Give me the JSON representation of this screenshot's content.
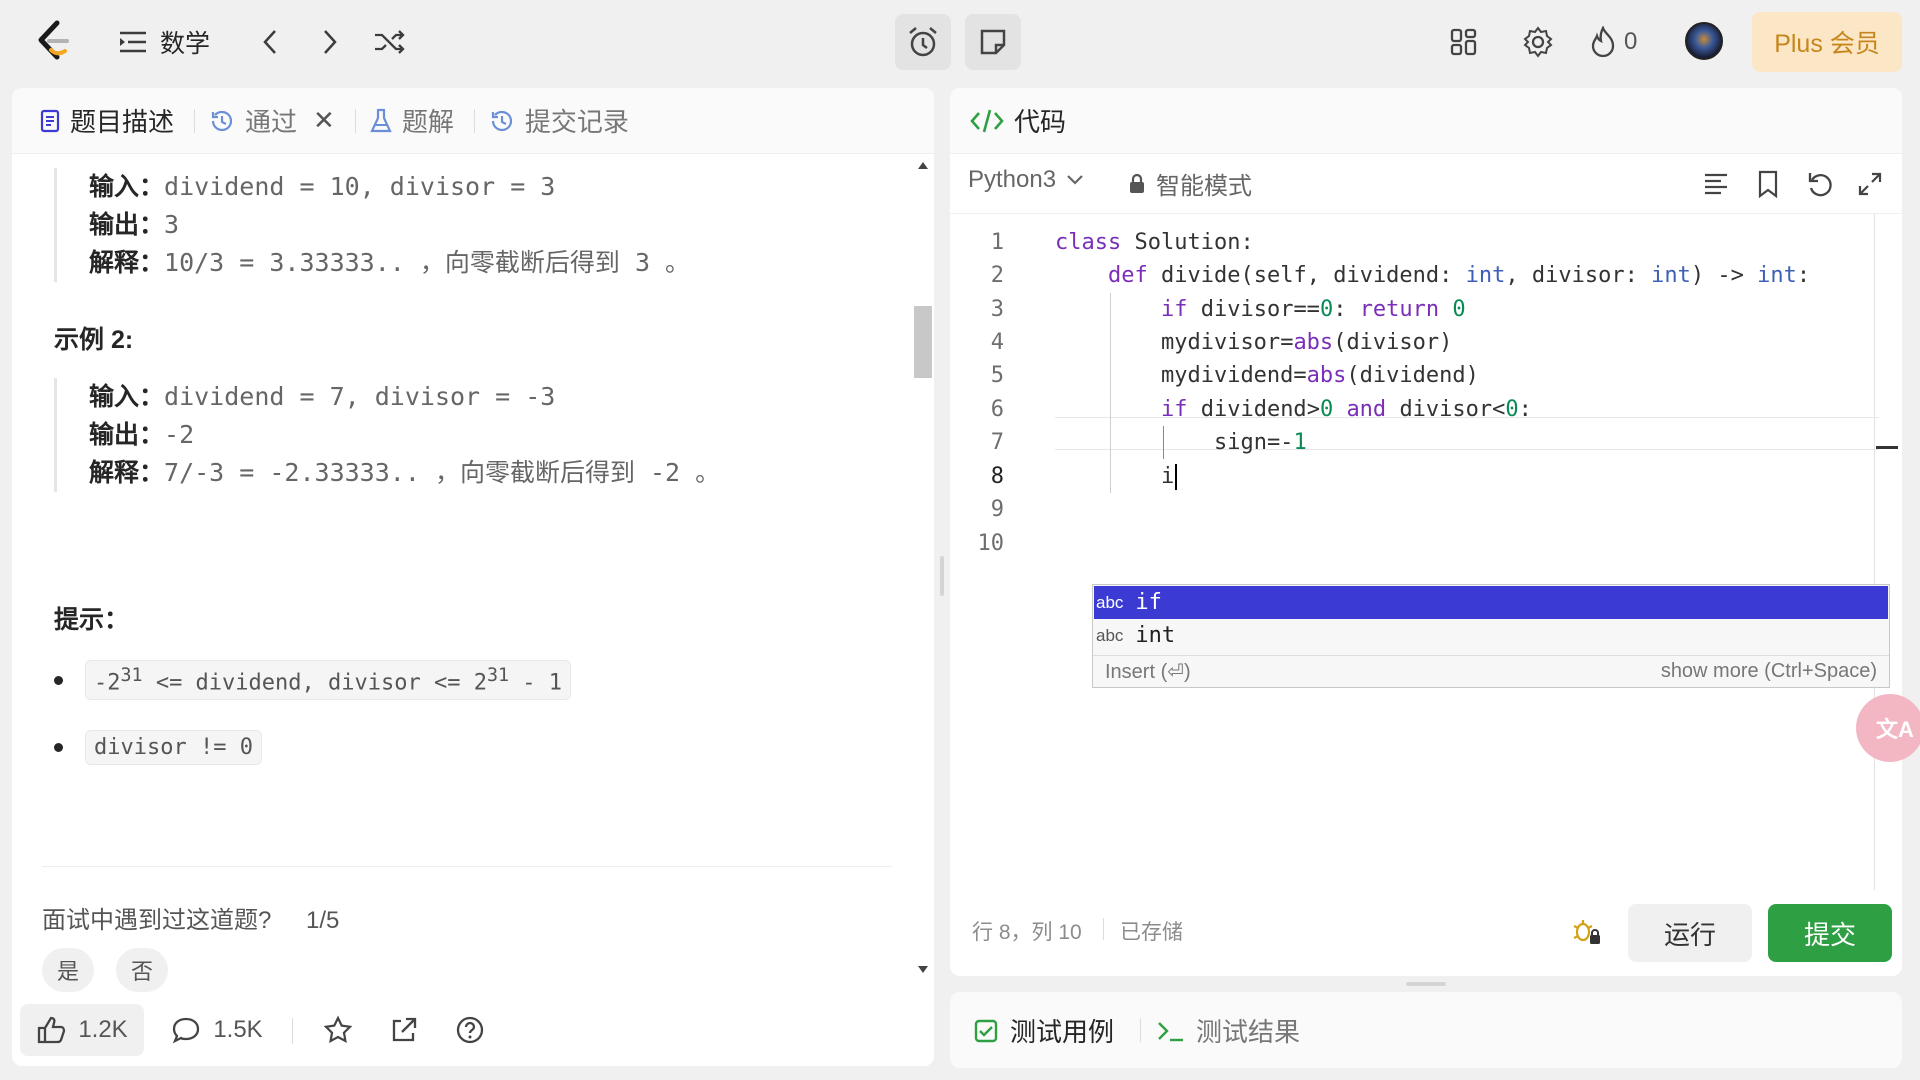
{
  "topbar": {
    "problem_list_label": "数学",
    "streak_count": "0",
    "plus_label": "Plus 会员"
  },
  "left_panel": {
    "tabs": [
      {
        "label": "题目描述"
      },
      {
        "label": "通过"
      },
      {
        "label": "题解"
      },
      {
        "label": "提交记录"
      }
    ],
    "example1": {
      "input_key": "输入：",
      "input_val": "dividend = 10, divisor = 3",
      "output_key": "输出：",
      "output_val": "3",
      "explain_key": "解释：",
      "explain_val": "10/3 = 3.33333.. ，向零截断后得到 3 。"
    },
    "example2_title": "示例 2:",
    "example2": {
      "input_key": "输入：",
      "input_val": "dividend = 7, divisor = -3",
      "output_key": "输出：",
      "output_val": "-2",
      "explain_key": "解释：",
      "explain_val": "7/-3 = -2.33333.. ，向零截断后得到 -2 。"
    },
    "hints_title": "提示：",
    "hint1_pre": "-2",
    "hint1_sup": "31",
    "hint1_mid": " <= dividend, divisor <= 2",
    "hint1_sup2": "31",
    "hint1_post": " - 1",
    "hint2": "divisor != 0",
    "interview_question": "面试中遇到过这道题?",
    "interview_count": "1/5",
    "yes_label": "是",
    "no_label": "否",
    "likes": "1.2K",
    "comments": "1.5K"
  },
  "right_panel": {
    "title": "代码",
    "language": "Python3",
    "mode": "智能模式",
    "code_lines": [
      "class Solution:",
      "    def divide(self, dividend: int, divisor: int) -> int:",
      "        if divisor==0: return 0",
      "        mydivisor=abs(divisor)",
      "        mydividend=abs(dividend)",
      "        if dividend>0 and divisor<0:",
      "            sign=-1",
      "        i",
      "",
      ""
    ],
    "line_numbers": [
      "1",
      "2",
      "3",
      "4",
      "5",
      "6",
      "7",
      "8",
      "9",
      "10"
    ],
    "autocomplete": {
      "items": [
        {
          "tag": "abc",
          "label": "if"
        },
        {
          "tag": "abc",
          "label": "int"
        }
      ],
      "insert_hint": "Insert (⏎)",
      "more_hint": "show more (Ctrl+Space)"
    },
    "status_position": "行 8，列 10",
    "status_saved": "已存储",
    "run_label": "运行",
    "submit_label": "提交"
  },
  "bottom_panel": {
    "testcase_label": "测试用例",
    "result_label": "测试结果"
  },
  "colors": {
    "accent_blue": "#3b3bd4",
    "submit_green": "#2ea043",
    "plus_bg": "#fbe7c6",
    "plus_text": "#c7861c"
  }
}
